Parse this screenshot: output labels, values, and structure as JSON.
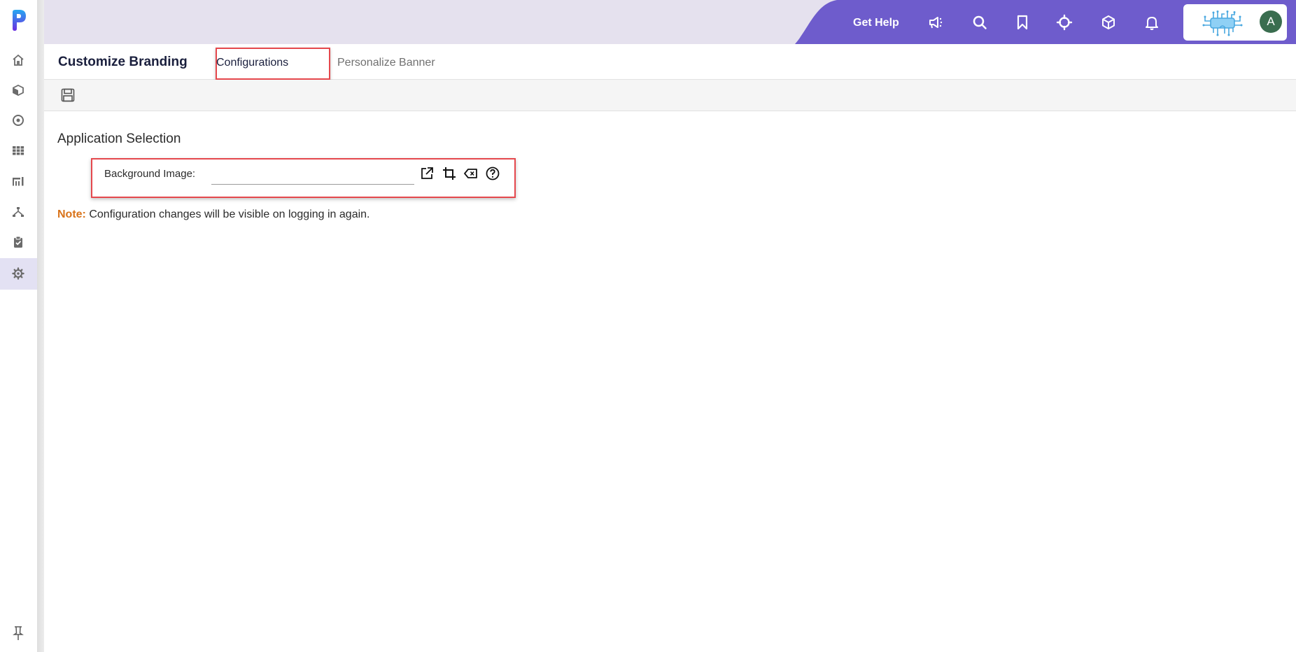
{
  "app": {
    "logo": "p-logo"
  },
  "sidebar": {
    "items": [
      {
        "name": "home",
        "icon": "home-icon"
      },
      {
        "name": "products",
        "icon": "cube-icon"
      },
      {
        "name": "target",
        "icon": "target-icon"
      },
      {
        "name": "grid",
        "icon": "grid-icon"
      },
      {
        "name": "reports",
        "icon": "chart-icon"
      },
      {
        "name": "hierarchy",
        "icon": "hierarchy-icon"
      },
      {
        "name": "tasks",
        "icon": "clipboard-check-icon"
      },
      {
        "name": "settings",
        "icon": "gear-icon",
        "active": true
      }
    ],
    "pin_icon": "pin-icon"
  },
  "header": {
    "get_help": "Get Help",
    "icons": [
      "megaphone-icon",
      "search-icon",
      "bookmark-icon",
      "crosshair-icon",
      "cube-icon",
      "bell-icon"
    ],
    "avatar_initial": "A",
    "accent_color": "#6e5ccc",
    "avatar_color": "#3a6d4f"
  },
  "page": {
    "title": "Customize Branding",
    "tabs": [
      {
        "label": "Configurations",
        "active": true
      },
      {
        "label": "Personalize Banner",
        "active": false
      }
    ]
  },
  "toolbar": {
    "save_icon": "save-icon"
  },
  "section": {
    "title": "Application Selection",
    "fields": [
      {
        "label": "Background Image:",
        "value": "",
        "actions": [
          "open-external-icon",
          "crop-icon",
          "clear-icon",
          "help-icon"
        ]
      }
    ]
  },
  "note": {
    "label": "Note:",
    "text": " Configuration changes will be visible on logging in again."
  }
}
